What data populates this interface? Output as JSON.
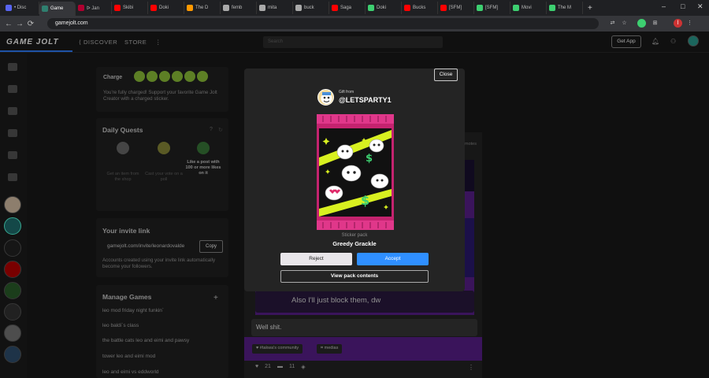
{
  "browser": {
    "tabs": [
      {
        "label": "• Disc",
        "color": "#5865f2"
      },
      {
        "label": "Game",
        "color": "#2f7f6f",
        "active": true
      },
      {
        "label": "ᐅ Jan",
        "color": "#b00030"
      },
      {
        "label": "Skibi",
        "color": "#ff0000"
      },
      {
        "label": "Doki",
        "color": "#ff0000"
      },
      {
        "label": "The D",
        "color": "#ff9900"
      },
      {
        "label": "femb",
        "color": "#aaaaaa"
      },
      {
        "label": "mita",
        "color": "#aaaaaa"
      },
      {
        "label": "buck",
        "color": "#aaaaaa"
      },
      {
        "label": "Saga",
        "color": "#ff0000"
      },
      {
        "label": "Doki",
        "color": "#3dcf70"
      },
      {
        "label": "Bucks",
        "color": "#ff0000"
      },
      {
        "label": "[SFM]",
        "color": "#ff0000"
      },
      {
        "label": "[SFM]",
        "color": "#3dcf70"
      },
      {
        "label": "Movi",
        "color": "#3dcf70"
      },
      {
        "label": "The M",
        "color": "#3dcf70"
      }
    ],
    "new_tab": "+",
    "url": "gamejolt.com"
  },
  "topbar": {
    "logo": "GAME JOLT",
    "discover": "DISCOVER",
    "store": "STORE",
    "more": "⋮",
    "search_placeholder": "Search",
    "get_app": "Get App"
  },
  "charge": {
    "title": "Charge",
    "text": "You're fully charged! Support your favorite Game Jolt Creator with a charged sticker."
  },
  "quests": {
    "title": "Daily Quests",
    "items": [
      {
        "label": "Get an item from the shop"
      },
      {
        "label": "Cast your vote on a poll"
      },
      {
        "label": "Like a post with 100 or more likes on it"
      }
    ]
  },
  "invite": {
    "title": "Your invite link",
    "link": "gamejolt.com/invite/leonardovalde",
    "copy": "Copy",
    "text": "Accounts created using your invite link automatically become your followers."
  },
  "manage": {
    "title": "Manage Games",
    "add": "+",
    "games": [
      "leo mod friday night funkin´",
      "leo baldi´s class",
      "the battle cats leo and eimi and pawsy",
      "tower leo and eimi mod",
      "leo and eimi vs eddworld"
    ]
  },
  "feed": {
    "notes": "motes",
    "message": "Also I'll just block them, dw",
    "comment": "Well shit.",
    "tags": [
      "#takwa's community",
      "medias"
    ],
    "likes": "21",
    "comments": "11"
  },
  "modal": {
    "close": "Close",
    "gift_from": "Gift from",
    "username": "@LETSPARTY1",
    "pack_type": "Sticker pack",
    "pack_name": "Greedy Grackle",
    "reject": "Reject",
    "accept": "Accept",
    "view_pack": "View pack contents"
  }
}
